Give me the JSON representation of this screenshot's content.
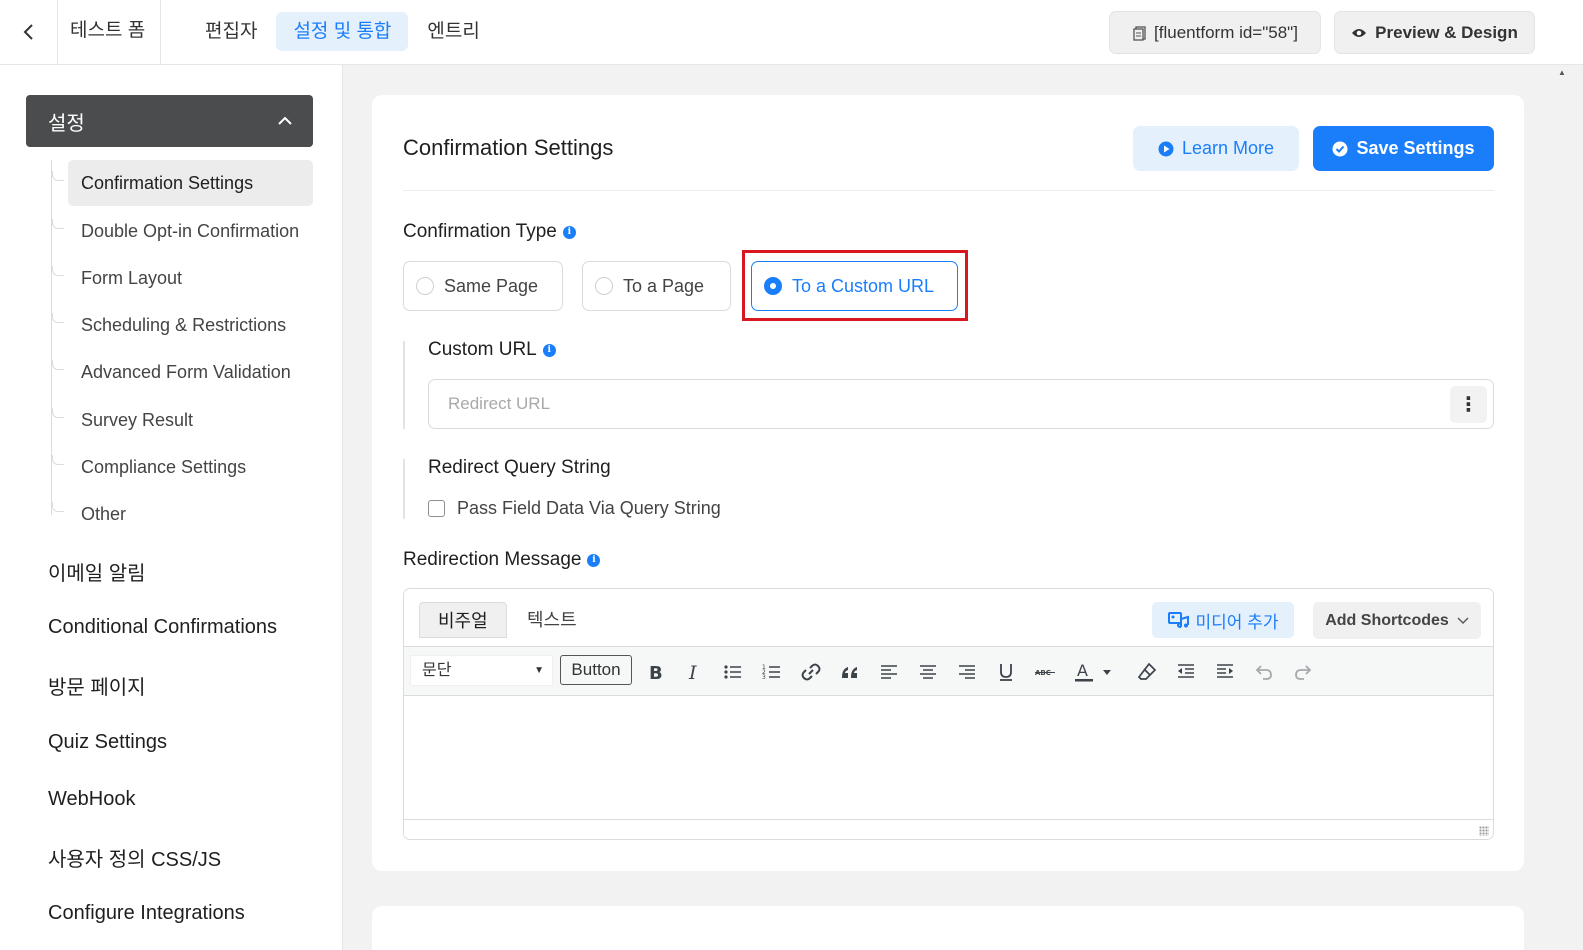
{
  "topbar": {
    "back_icon": "chevron-left-icon",
    "form_title": "테스트 폼",
    "tabs": [
      {
        "label": "편집자",
        "active": false
      },
      {
        "label": "설정 및 통합",
        "active": true
      },
      {
        "label": "엔트리",
        "active": false
      }
    ],
    "shortcode_label": "[fluentform id=\"58\"]",
    "preview_label": "Preview & Design"
  },
  "sidebar": {
    "settings_header": "설정",
    "sub_items": [
      {
        "label": "Confirmation Settings",
        "active": true
      },
      {
        "label": "Double Opt-in Confirmation",
        "active": false
      },
      {
        "label": "Form Layout",
        "active": false
      },
      {
        "label": "Scheduling & Restrictions",
        "active": false
      },
      {
        "label": "Advanced Form Validation",
        "active": false
      },
      {
        "label": "Survey Result",
        "active": false
      },
      {
        "label": "Compliance Settings",
        "active": false
      },
      {
        "label": "Other",
        "active": false
      }
    ],
    "main_items": [
      {
        "label": "이메일 알림"
      },
      {
        "label": "Conditional Confirmations"
      },
      {
        "label": "방문 페이지"
      },
      {
        "label": "Quiz Settings"
      },
      {
        "label": "WebHook"
      },
      {
        "label": "사용자 정의 CSS/JS"
      },
      {
        "label": "Configure Integrations"
      }
    ]
  },
  "panel": {
    "title": "Confirmation Settings",
    "learn_more": "Learn More",
    "save_settings": "Save Settings",
    "confirmation_type_label": "Confirmation Type",
    "confirmation_options": [
      {
        "label": "Same Page",
        "selected": false
      },
      {
        "label": "To a Page",
        "selected": false
      },
      {
        "label": "To a Custom URL",
        "selected": true
      }
    ],
    "custom_url_label": "Custom URL",
    "custom_url_placeholder": "Redirect URL",
    "custom_url_value": "",
    "query_string_label": "Redirect Query String",
    "pass_field_data_label": "Pass Field Data Via Query String",
    "pass_field_data_checked": false,
    "redirection_message_label": "Redirection Message"
  },
  "editor": {
    "tabs": [
      {
        "label": "비주얼",
        "active": true
      },
      {
        "label": "텍스트",
        "active": false
      }
    ],
    "add_media": "미디어 추가",
    "add_shortcodes": "Add Shortcodes",
    "format_select": "문단",
    "button_chip": "Button",
    "content": ""
  },
  "colors": {
    "accent": "#1a7efb",
    "accent_light": "#e5f0fd",
    "sidebar_header": "#4b4c4d",
    "highlight": "#d8161f"
  }
}
